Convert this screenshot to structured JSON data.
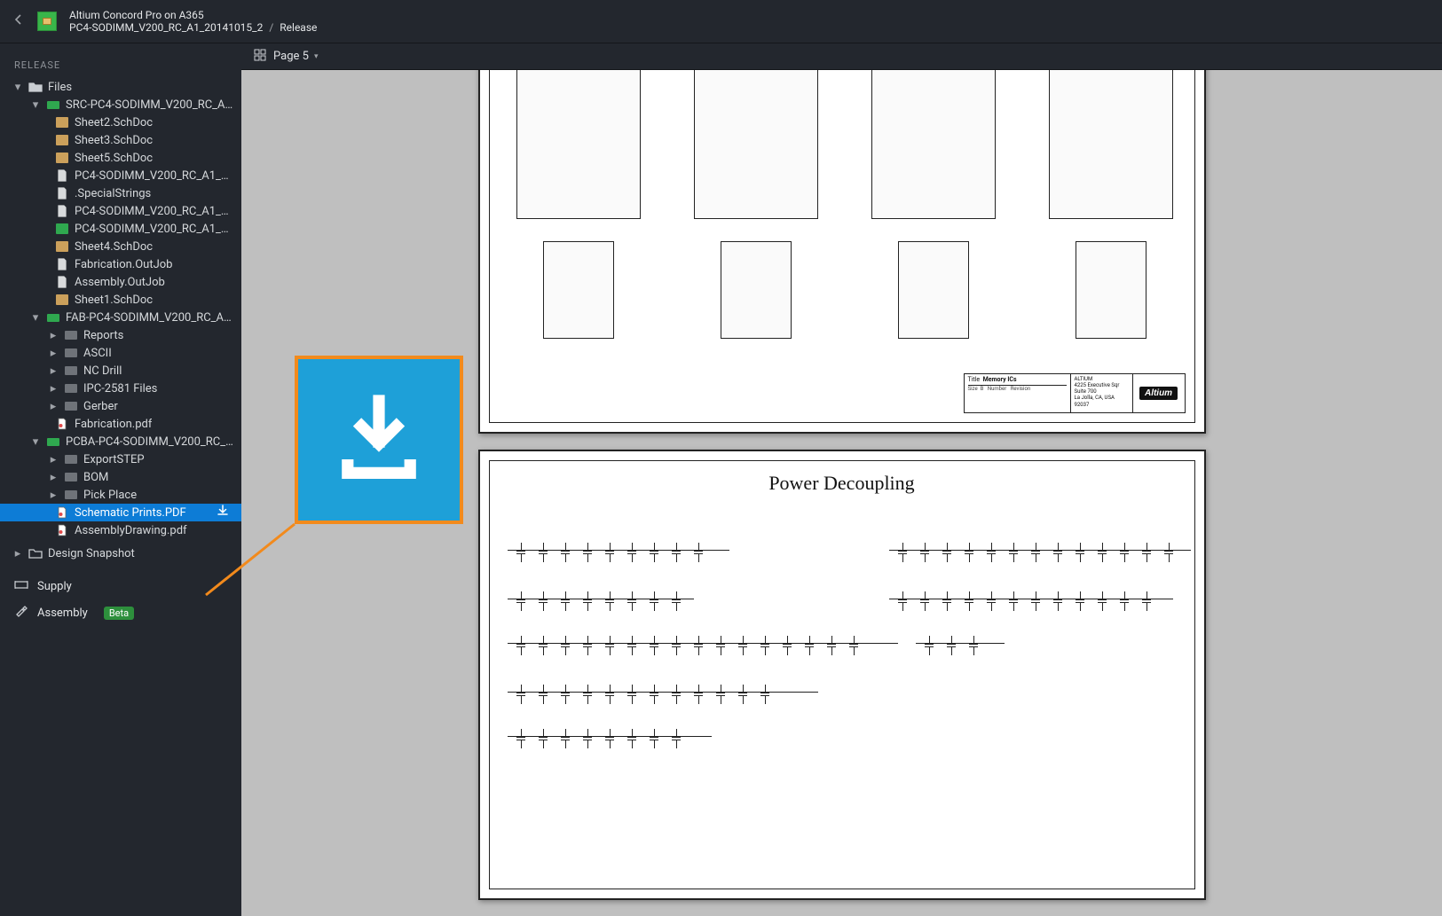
{
  "header": {
    "title": "Altium Concord Pro on A365",
    "breadcrumb": {
      "item": "PC4-SODIMM_V200_RC_A1_20141015_2",
      "sep": "/",
      "page": "Release"
    }
  },
  "sidebar": {
    "section": "RELEASE",
    "root": {
      "label": "Files"
    },
    "groups": [
      {
        "label": "SRC-PC4-SODIMM_V200_RC_A1_201...",
        "expanded": true,
        "icon": "green",
        "items": [
          {
            "label": "Sheet2.SchDoc",
            "icon": "tan"
          },
          {
            "label": "Sheet3.SchDoc",
            "icon": "tan"
          },
          {
            "label": "Sheet5.SchDoc",
            "icon": "tan"
          },
          {
            "label": "PC4-SODIMM_V200_RC_A1_2014...",
            "icon": "file"
          },
          {
            "label": ".SpecialStrings",
            "icon": "file"
          },
          {
            "label": "PC4-SODIMM_V200_RC_A1_2014...",
            "icon": "file"
          },
          {
            "label": "PC4-SODIMM_V200_RC_A1_2014...",
            "icon": "greenfile"
          },
          {
            "label": "Sheet4.SchDoc",
            "icon": "tan"
          },
          {
            "label": "Fabrication.OutJob",
            "icon": "file"
          },
          {
            "label": "Assembly.OutJob",
            "icon": "file"
          },
          {
            "label": "Sheet1.SchDoc",
            "icon": "tan"
          }
        ]
      },
      {
        "label": "FAB-PC4-SODIMM_V200_RC_A1_201...",
        "expanded": true,
        "icon": "green",
        "items": [
          {
            "label": "Reports",
            "icon": "folder",
            "chev": true
          },
          {
            "label": "ASCII",
            "icon": "folder",
            "chev": true
          },
          {
            "label": "NC Drill",
            "icon": "folder",
            "chev": true
          },
          {
            "label": "IPC-2581 Files",
            "icon": "folder",
            "chev": true
          },
          {
            "label": "Gerber",
            "icon": "folder",
            "chev": true
          },
          {
            "label": "Fabrication.pdf",
            "icon": "pdf"
          }
        ]
      },
      {
        "label": "PCBA-PC4-SODIMM_V200_RC_A1_20...",
        "expanded": true,
        "icon": "green",
        "items": [
          {
            "label": "ExportSTEP",
            "icon": "folder",
            "chev": true
          },
          {
            "label": "BOM",
            "icon": "folder",
            "chev": true
          },
          {
            "label": "Pick Place",
            "icon": "folder",
            "chev": true
          },
          {
            "label": "Schematic Prints.PDF",
            "icon": "pdf",
            "selected": true,
            "download": true
          },
          {
            "label": "AssemblyDrawing.pdf",
            "icon": "pdf"
          }
        ]
      }
    ],
    "designSnapshot": "Design Snapshot",
    "supply": "Supply",
    "assembly": {
      "label": "Assembly",
      "badge": "Beta"
    }
  },
  "toolbar": {
    "page_label": "Page 5"
  },
  "viewer": {
    "file_type": "PDF",
    "beta": "Beta",
    "sheet1_title": "Memory ICs",
    "sheet2_title": "Power Decoupling",
    "brand": "Altium"
  },
  "colors": {
    "accent": "#0d7cd6",
    "callout_fill": "#1ea0d8",
    "callout_border": "#f28a1c",
    "badge_green": "#2d8f3c"
  }
}
